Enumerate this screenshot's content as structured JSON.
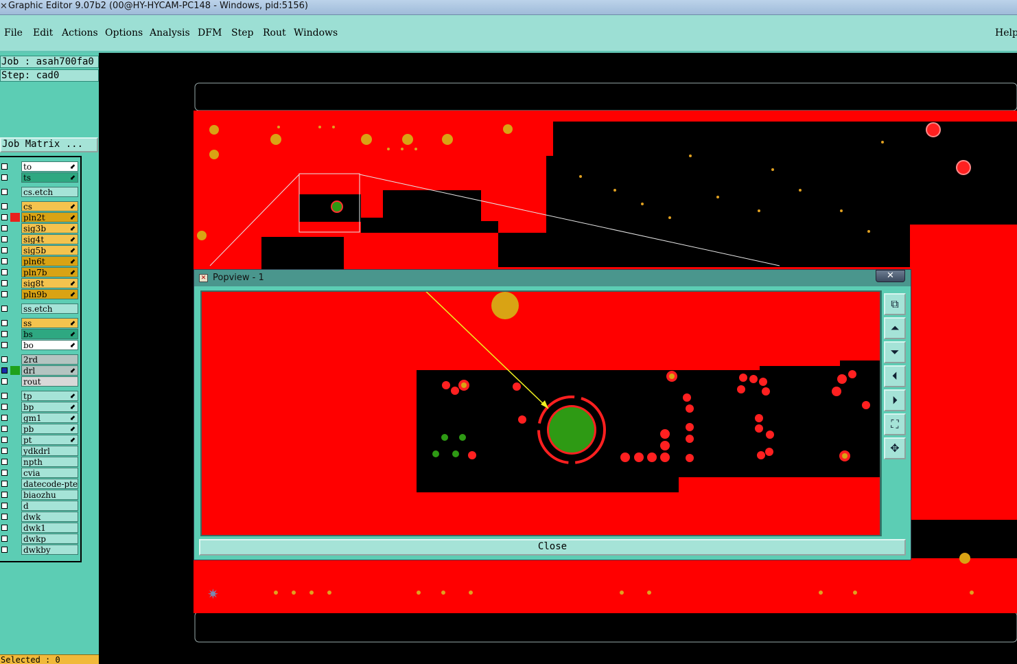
{
  "window": {
    "title": "Graphic Editor 9.07b2 (00@HY-HYCAM-PC148 - Windows, pid:5156)"
  },
  "menu": {
    "file": "File",
    "edit": "Edit",
    "actions": "Actions",
    "options": "Options",
    "analysis": "Analysis",
    "dfm": "DFM",
    "step": "Step",
    "rout": "Rout",
    "windows": "Windows",
    "help": "Help"
  },
  "job": {
    "job_line": "Job : asah700fa0",
    "step_line": "Step: cad0",
    "matrix_button": "Job Matrix ..."
  },
  "layers": [
    {
      "name": "to",
      "color": "#ffffff",
      "mark": true
    },
    {
      "name": "ts",
      "color": "#2ea881",
      "mark": true
    },
    {
      "name": "cs.etch",
      "color": "#a5e3d7",
      "mark": false
    },
    {
      "name": "cs",
      "color": "#f4c34e",
      "mark": true
    },
    {
      "name": "pln2t",
      "color": "#d9a314",
      "mark": true,
      "swatch": "#e8211d"
    },
    {
      "name": "sig3b",
      "color": "#f4c34e",
      "mark": true
    },
    {
      "name": "sig4t",
      "color": "#f4c34e",
      "mark": true
    },
    {
      "name": "sig5b",
      "color": "#f4c34e",
      "mark": true
    },
    {
      "name": "pln6t",
      "color": "#d9a314",
      "mark": true
    },
    {
      "name": "pln7b",
      "color": "#d9a314",
      "mark": true
    },
    {
      "name": "sig8t",
      "color": "#f4c34e",
      "mark": true
    },
    {
      "name": "pln9b",
      "color": "#d9a314",
      "mark": true
    },
    {
      "name": "ss.etch",
      "color": "#a5e3d7",
      "mark": false
    },
    {
      "name": "ss",
      "color": "#f4c34e",
      "mark": true
    },
    {
      "name": "bs",
      "color": "#2ea881",
      "mark": true
    },
    {
      "name": "bo",
      "color": "#ffffff",
      "mark": true
    },
    {
      "name": "2rd",
      "color": "#b4c4c1",
      "mark": false
    },
    {
      "name": "drl",
      "color": "#b4c4c1",
      "mark": true,
      "swatch": "#1fa11a",
      "checked_blue": true
    },
    {
      "name": "rout",
      "color": "#d8d8d8",
      "mark": false
    },
    {
      "name": "tp",
      "color": "#a5e3d7",
      "mark": true
    },
    {
      "name": "bp",
      "color": "#a5e3d7",
      "mark": true
    },
    {
      "name": "gm1",
      "color": "#a5e3d7",
      "mark": true
    },
    {
      "name": "pb",
      "color": "#a5e3d7",
      "mark": true
    },
    {
      "name": "pt",
      "color": "#a5e3d7",
      "mark": true
    },
    {
      "name": "ydkdrl",
      "color": "#a5e3d7",
      "mark": false
    },
    {
      "name": "npth",
      "color": "#a5e3d7",
      "mark": false
    },
    {
      "name": "cvia",
      "color": "#a5e3d7",
      "mark": false
    },
    {
      "name": "datecode-pte",
      "color": "#a5e3d7",
      "mark": false
    },
    {
      "name": "biaozhu",
      "color": "#a5e3d7",
      "mark": false
    },
    {
      "name": "d",
      "color": "#a5e3d7",
      "mark": false
    },
    {
      "name": "dwk",
      "color": "#a5e3d7",
      "mark": false
    },
    {
      "name": "dwk1",
      "color": "#a5e3d7",
      "mark": false
    },
    {
      "name": "dwkp",
      "color": "#a5e3d7",
      "mark": false
    },
    {
      "name": "dwkby",
      "color": "#a5e3d7",
      "mark": false
    }
  ],
  "status": {
    "selected": "Selected : 0"
  },
  "popview": {
    "title": "Popview - 1",
    "close_x": "✕",
    "close_button": "Close",
    "tools": [
      {
        "name": "zoom-window-icon",
        "glyph": "⧉"
      },
      {
        "name": "pan-up-icon",
        "glyph": "⏶"
      },
      {
        "name": "pan-down-icon",
        "glyph": "⏷"
      },
      {
        "name": "pan-left-icon",
        "glyph": "⏴"
      },
      {
        "name": "pan-right-icon",
        "glyph": "⏵"
      },
      {
        "name": "zoom-fit-icon",
        "glyph": "⛶"
      },
      {
        "name": "zoom-home-icon",
        "glyph": "✥"
      }
    ]
  },
  "colors": {
    "copper": "#ff0000",
    "pad": "#d9a314",
    "drill": "#2e9a14",
    "panel": "#5ccdb4",
    "menubar": "#9cdfd4"
  }
}
